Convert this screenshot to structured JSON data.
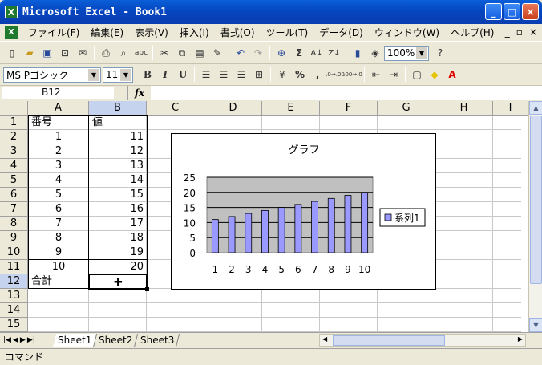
{
  "window": {
    "title": "Microsoft Excel - Book1",
    "app_icon": "X",
    "btn_min": "_",
    "btn_max": "□",
    "btn_close": "×"
  },
  "menubar": {
    "items": [
      "ファイル(F)",
      "編集(E)",
      "表示(V)",
      "挿入(I)",
      "書式(O)",
      "ツール(T)",
      "データ(D)",
      "ウィンドウ(W)",
      "ヘルプ(H)"
    ],
    "right": [
      "_",
      "▫",
      "×"
    ]
  },
  "toolbar1": {
    "zoom": "100%",
    "sum": "Σ",
    "help": "?"
  },
  "toolbar2": {
    "font": "MS Pゴシック",
    "size": "11",
    "bold": "B",
    "italic": "I",
    "underline": "U",
    "percent": "%",
    "comma": ",",
    "inc_dec": ".0→.00",
    "dec_dec": ".00→.0",
    "currency": "¥"
  },
  "formula": {
    "namebox": "B12",
    "fx": "fx",
    "content": ""
  },
  "columns": [
    "A",
    "B",
    "C",
    "D",
    "E",
    "F",
    "G",
    "H",
    "I"
  ],
  "rows": [
    "1",
    "2",
    "3",
    "4",
    "5",
    "6",
    "7",
    "8",
    "9",
    "10",
    "11",
    "12",
    "13",
    "14",
    "15"
  ],
  "cells": {
    "a1": "番号",
    "b1": "値",
    "a2": "1",
    "b2": "11",
    "a3": "2",
    "b3": "12",
    "a4": "3",
    "b4": "13",
    "a5": "4",
    "b5": "14",
    "a6": "5",
    "b6": "15",
    "a7": "6",
    "b7": "16",
    "a8": "7",
    "b8": "17",
    "a9": "8",
    "b9": "18",
    "a10": "9",
    "b10": "19",
    "a11": "10",
    "b11": "20",
    "a12": "合計"
  },
  "chart_data": {
    "type": "bar",
    "title": "グラフ",
    "categories": [
      "1",
      "2",
      "3",
      "4",
      "5",
      "6",
      "7",
      "8",
      "9",
      "10"
    ],
    "series": [
      {
        "name": "系列1",
        "values": [
          11,
          12,
          13,
          14,
          15,
          16,
          17,
          18,
          19,
          20
        ],
        "color": "#9999ff"
      }
    ],
    "yticks": [
      "0",
      "5",
      "10",
      "15",
      "20",
      "25"
    ],
    "ylim": [
      0,
      25
    ],
    "plot_bg": "#c0c0c0",
    "legend": "right",
    "grid": true
  },
  "sheets": [
    "Sheet1",
    "Sheet2",
    "Sheet3"
  ],
  "active_sheet": "Sheet1",
  "status": "コマンド"
}
